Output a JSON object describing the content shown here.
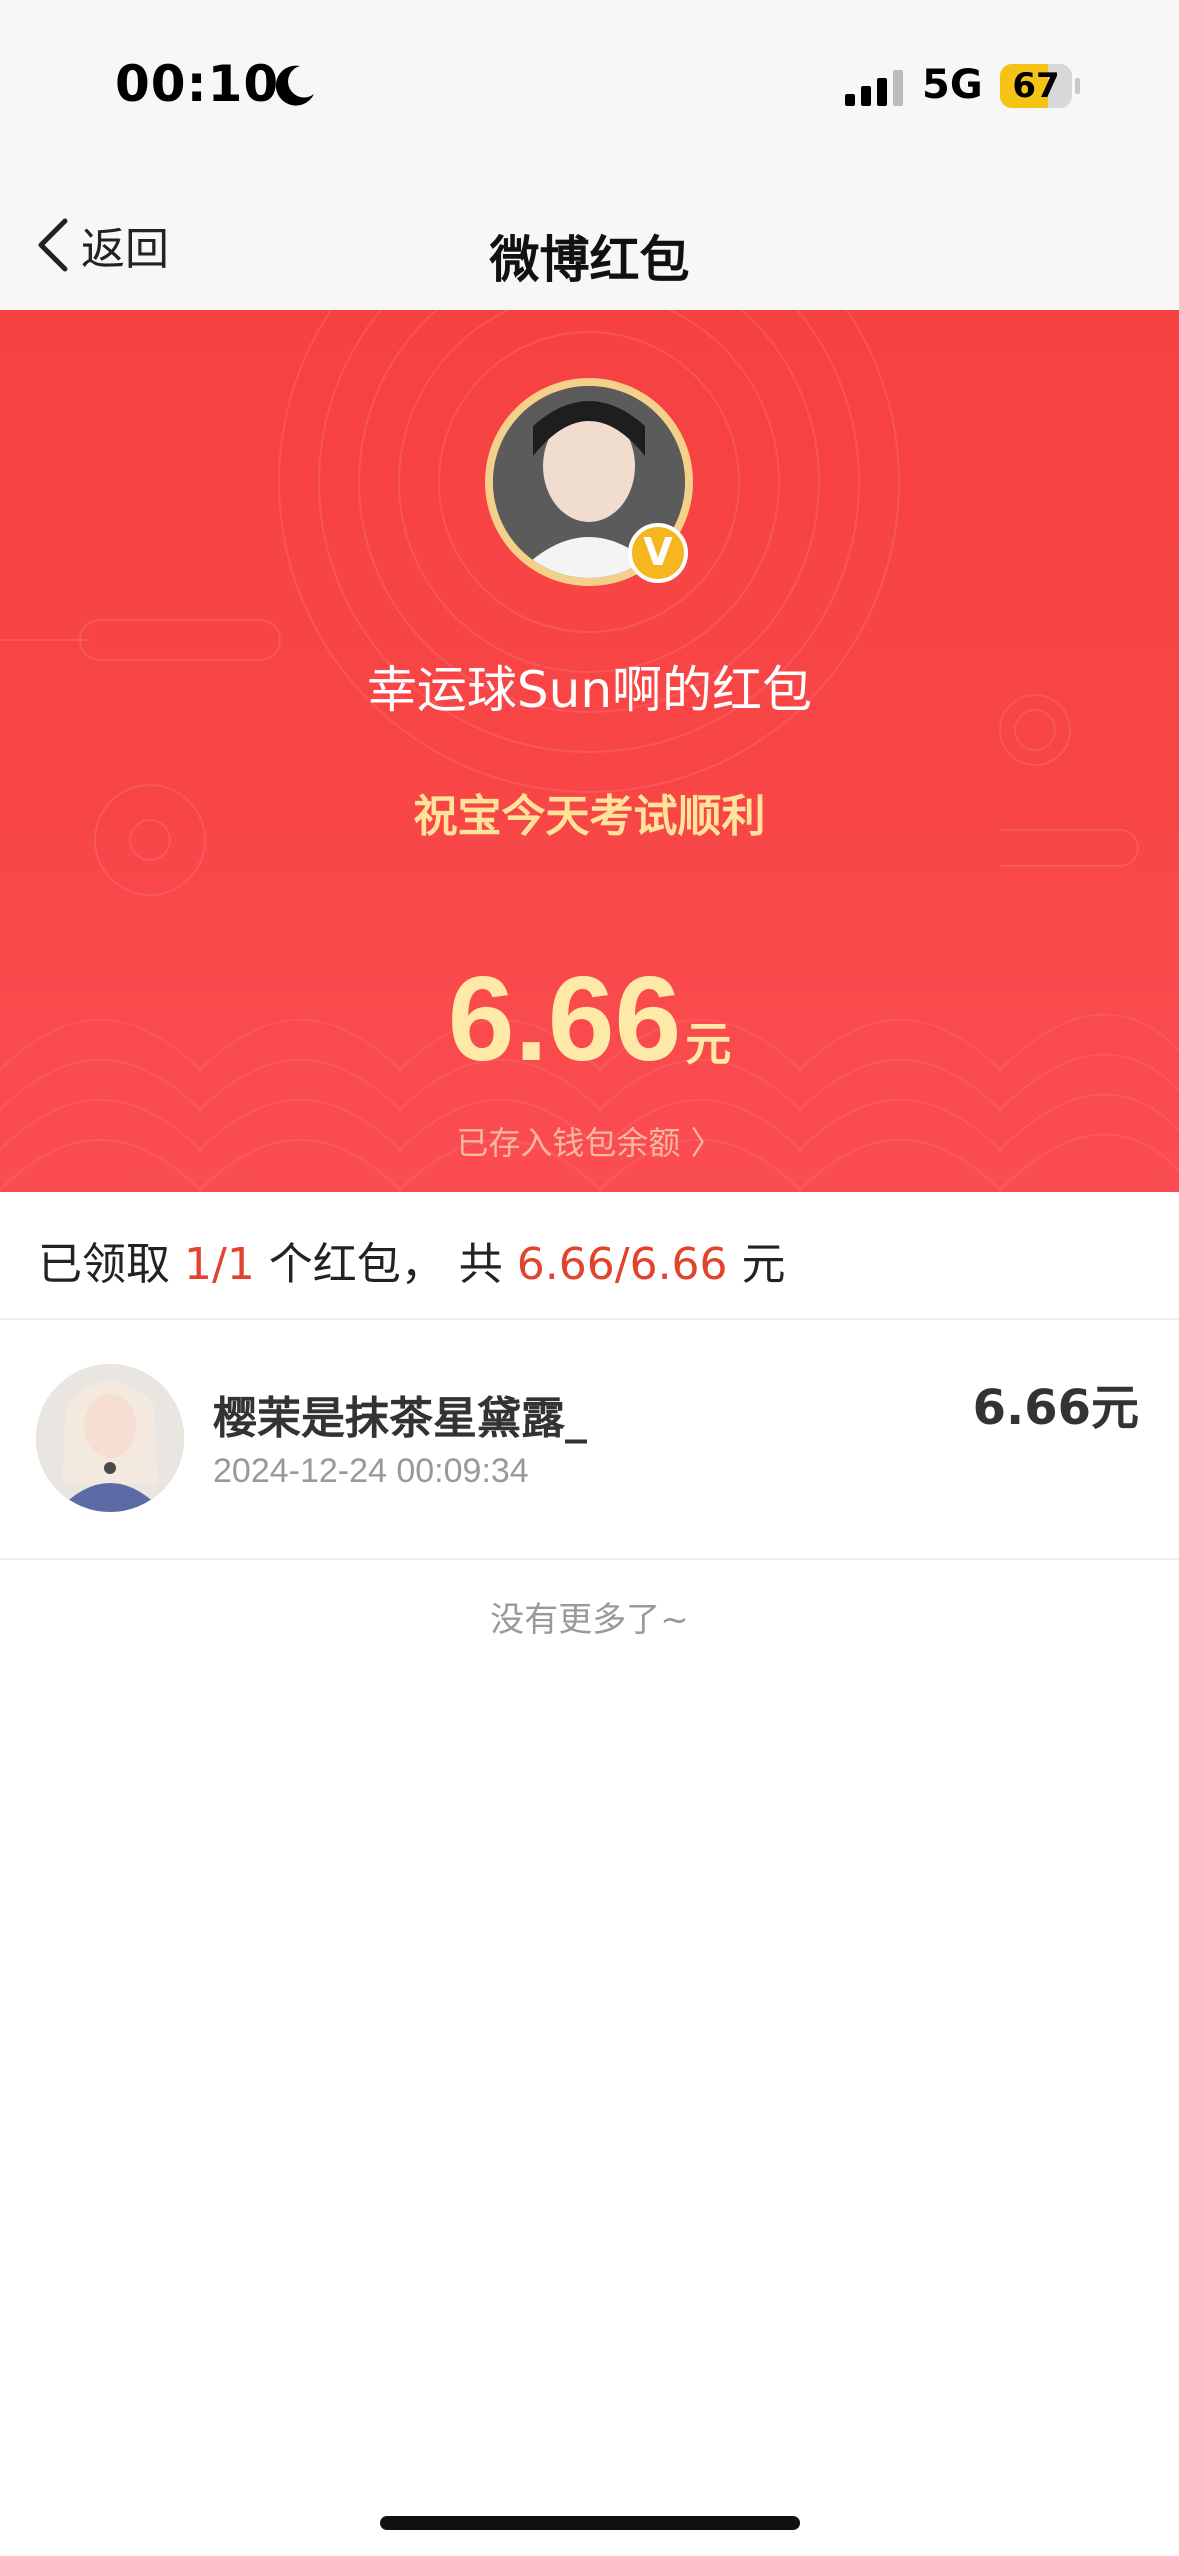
{
  "status_bar": {
    "time": "00:10",
    "network": "5G",
    "battery_level": "67",
    "battery_fraction": 0.67
  },
  "nav": {
    "back_label": "返回",
    "title": "微博红包"
  },
  "hero": {
    "sender_title": "幸运球Sun啊的红包",
    "blessing": "祝宝今天考试顺利",
    "amount": "6.66",
    "amount_unit": "元",
    "wallet_link": "已存入钱包余额 〉",
    "verified_badge": "V"
  },
  "summary": {
    "prefix": "已领取 ",
    "count": "1/1",
    "middle": " 个红包， 共 ",
    "total": "6.66/6.66",
    "suffix": " 元"
  },
  "records": [
    {
      "name": "樱茉是抹茶星黛露_",
      "time": "2024-12-24 00:09:34",
      "amount": "6.66元"
    }
  ],
  "footer": {
    "no_more": "没有更多了~"
  },
  "colors": {
    "hero_red": "#f64141",
    "highlight_red": "#e2432c",
    "gold": "#ffe9a6"
  }
}
